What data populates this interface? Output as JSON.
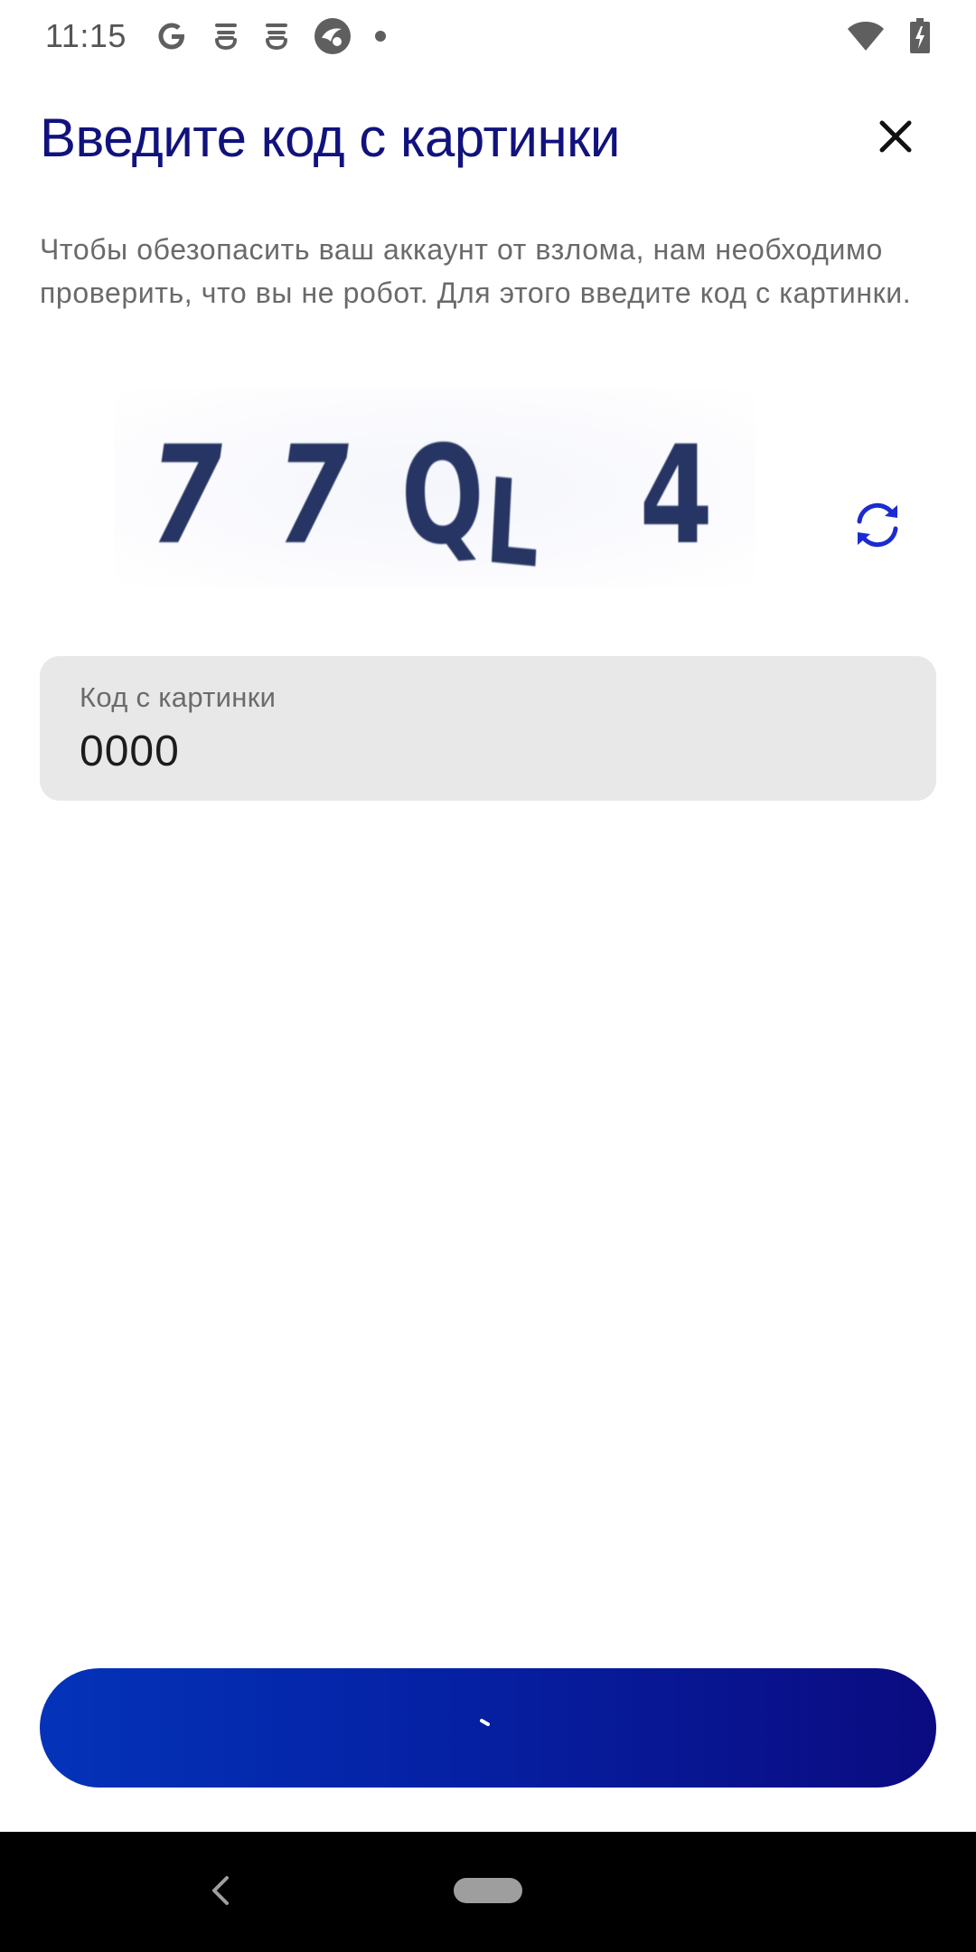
{
  "status_bar": {
    "time": "11:15",
    "left_icons": [
      "google-icon",
      "notification-icon",
      "notification-icon",
      "app-icon",
      "dot-icon"
    ],
    "right_icons": [
      "wifi-icon",
      "battery-charging-icon"
    ]
  },
  "header": {
    "title": "Введите код с картинки",
    "close_icon": "close-icon"
  },
  "description": "Чтобы обезопасить ваш аккаунт от взлома, нам необходимо проверить, что вы не робот. Для этого введите код с картинки.",
  "captcha": {
    "code": "77QL4",
    "refresh_icon": "refresh-icon"
  },
  "code_field": {
    "label": "Код с картинки",
    "value": "0000"
  },
  "submit_button": {
    "state": "loading",
    "icon": "spinner-icon"
  },
  "colors": {
    "title": "#11127d",
    "accent": "#1b2bd0",
    "button_start": "#0433b9",
    "button_end": "#0b0b80",
    "field_bg": "#e8e8e8"
  },
  "nav_bar": {
    "icons": [
      "back-icon",
      "home-pill"
    ]
  }
}
